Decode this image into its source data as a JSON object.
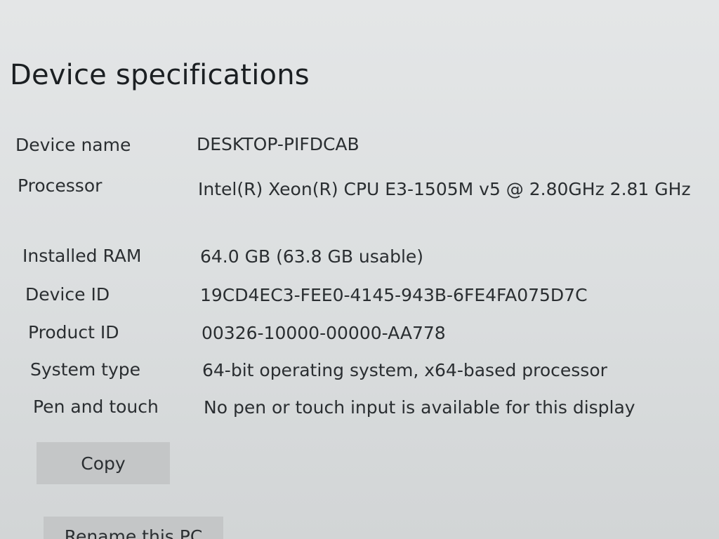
{
  "section_title": "Device specifications",
  "specs": [
    {
      "label": "Device name",
      "value": "DESKTOP-PIFDCAB"
    },
    {
      "label": "Processor",
      "value": "Intel(R) Xeon(R) CPU E3-1505M v5 @ 2.80GHz   2.81 GHz"
    },
    {
      "label": "Installed RAM",
      "value": "64.0 GB (63.8 GB usable)"
    },
    {
      "label": "Device ID",
      "value": "19CD4EC3-FEE0-4145-943B-6FE4FA075D7C"
    },
    {
      "label": "Product ID",
      "value": "00326-10000-00000-AA778"
    },
    {
      "label": "System type",
      "value": "64-bit operating system, x64-based processor"
    },
    {
      "label": "Pen and touch",
      "value": "No pen or touch input is available for this display"
    }
  ],
  "buttons": {
    "copy": "Copy",
    "rename": "Rename this PC"
  }
}
